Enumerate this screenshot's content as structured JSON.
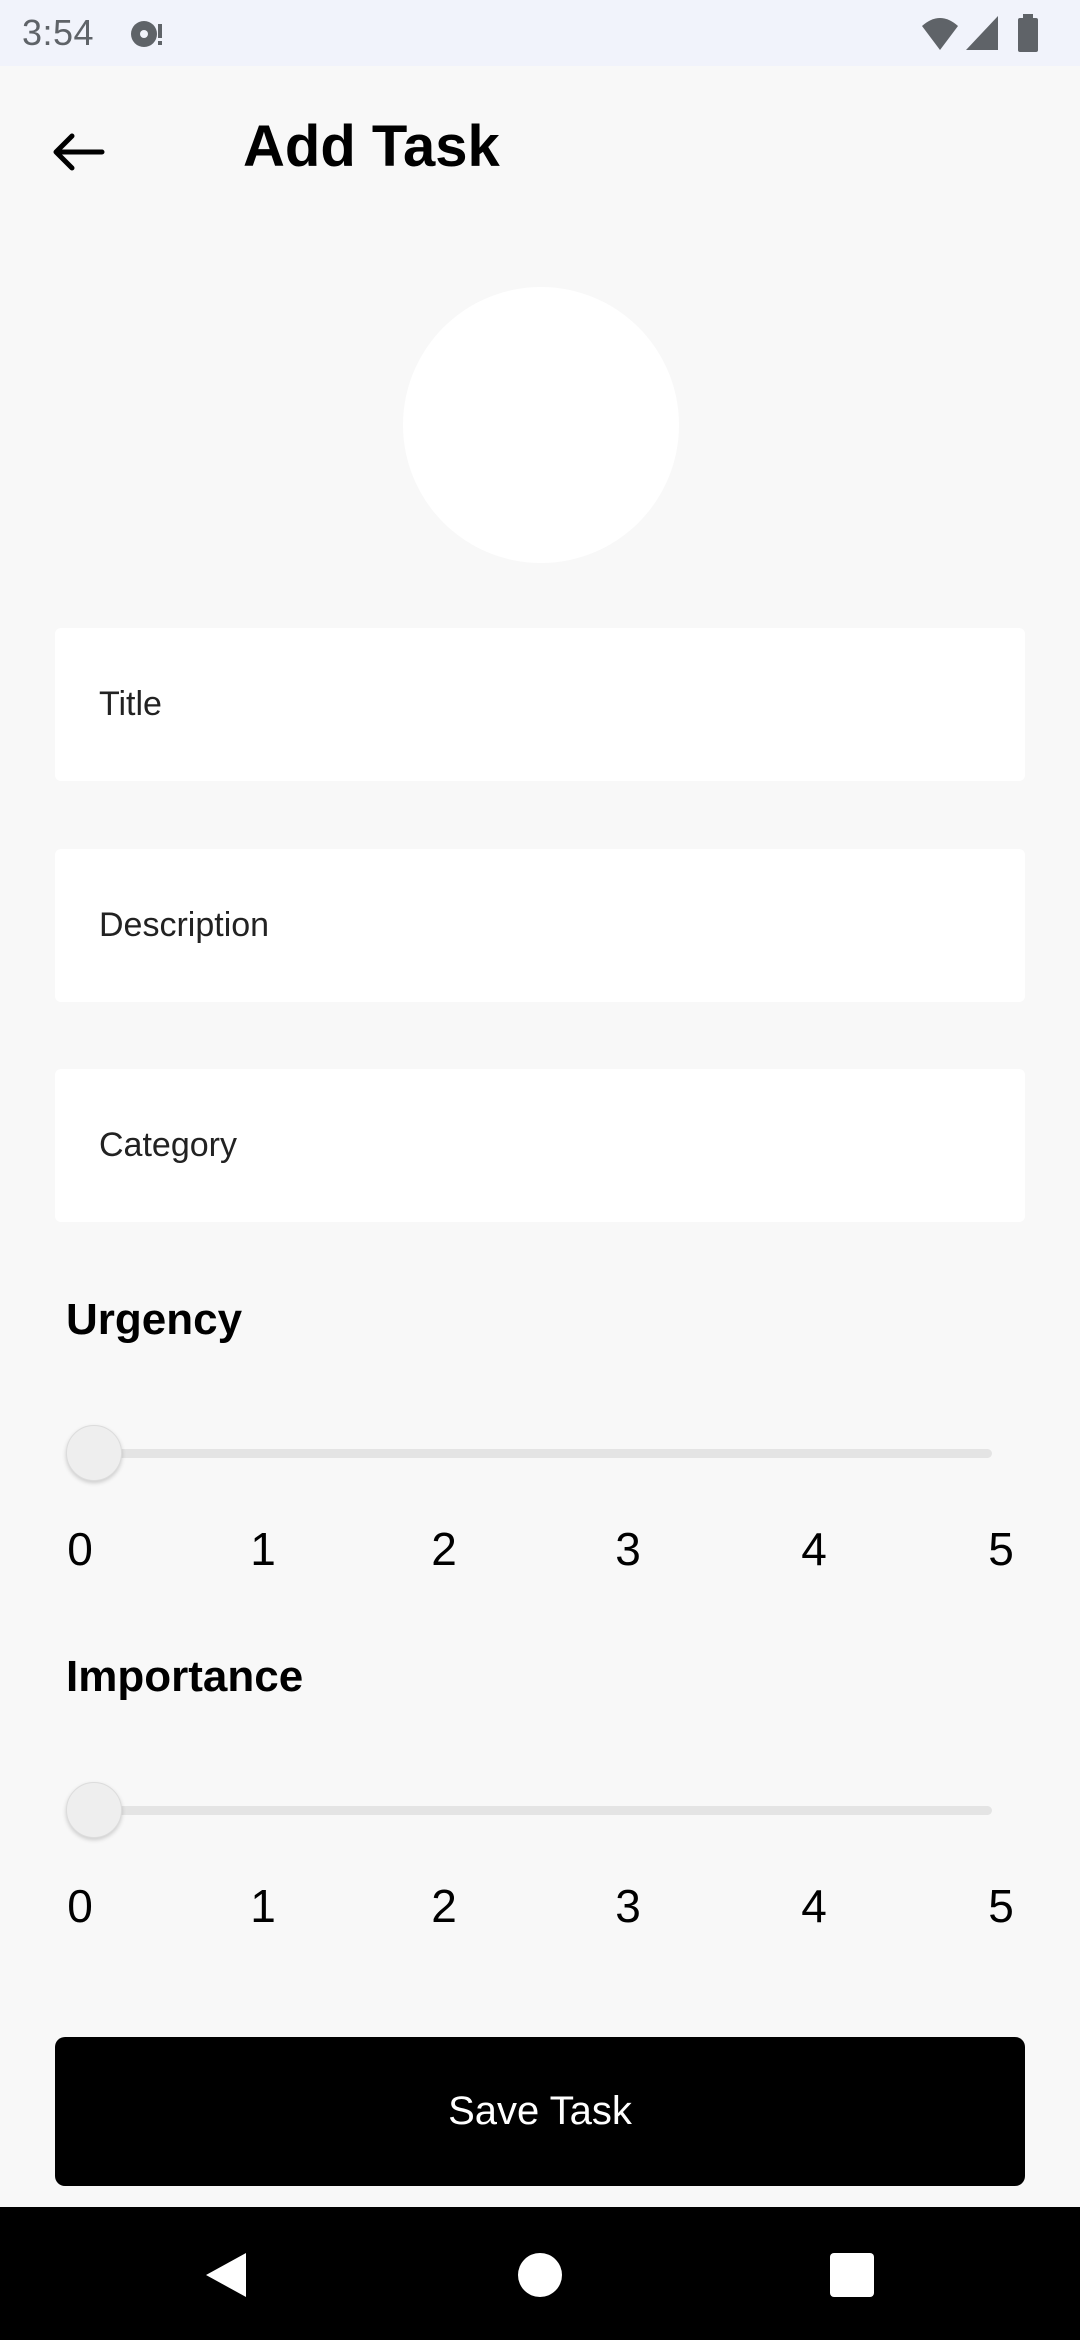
{
  "status_bar": {
    "time": "3:54",
    "icons": [
      "notification-icon",
      "wifi-icon",
      "signal-icon",
      "battery-icon"
    ]
  },
  "header": {
    "title": "Add Task",
    "back_icon": "arrow-left-icon"
  },
  "form": {
    "title_placeholder": "Title",
    "description_placeholder": "Description",
    "category_placeholder": "Category"
  },
  "urgency": {
    "label": "Urgency",
    "value": 0,
    "min": 0,
    "max": 5,
    "ticks": [
      "0",
      "1",
      "2",
      "3",
      "4",
      "5"
    ]
  },
  "importance": {
    "label": "Importance",
    "value": 0,
    "min": 0,
    "max": 5,
    "ticks": [
      "0",
      "1",
      "2",
      "3",
      "4",
      "5"
    ]
  },
  "save_button": {
    "label": "Save Task"
  },
  "nav_bar": {
    "icons": [
      "back-triangle-icon",
      "home-circle-icon",
      "recents-square-icon"
    ]
  },
  "colors": {
    "background": "#f8f8f8",
    "surface": "#ffffff",
    "primary_button": "#000000",
    "status_bar": "#f1f3fb"
  }
}
